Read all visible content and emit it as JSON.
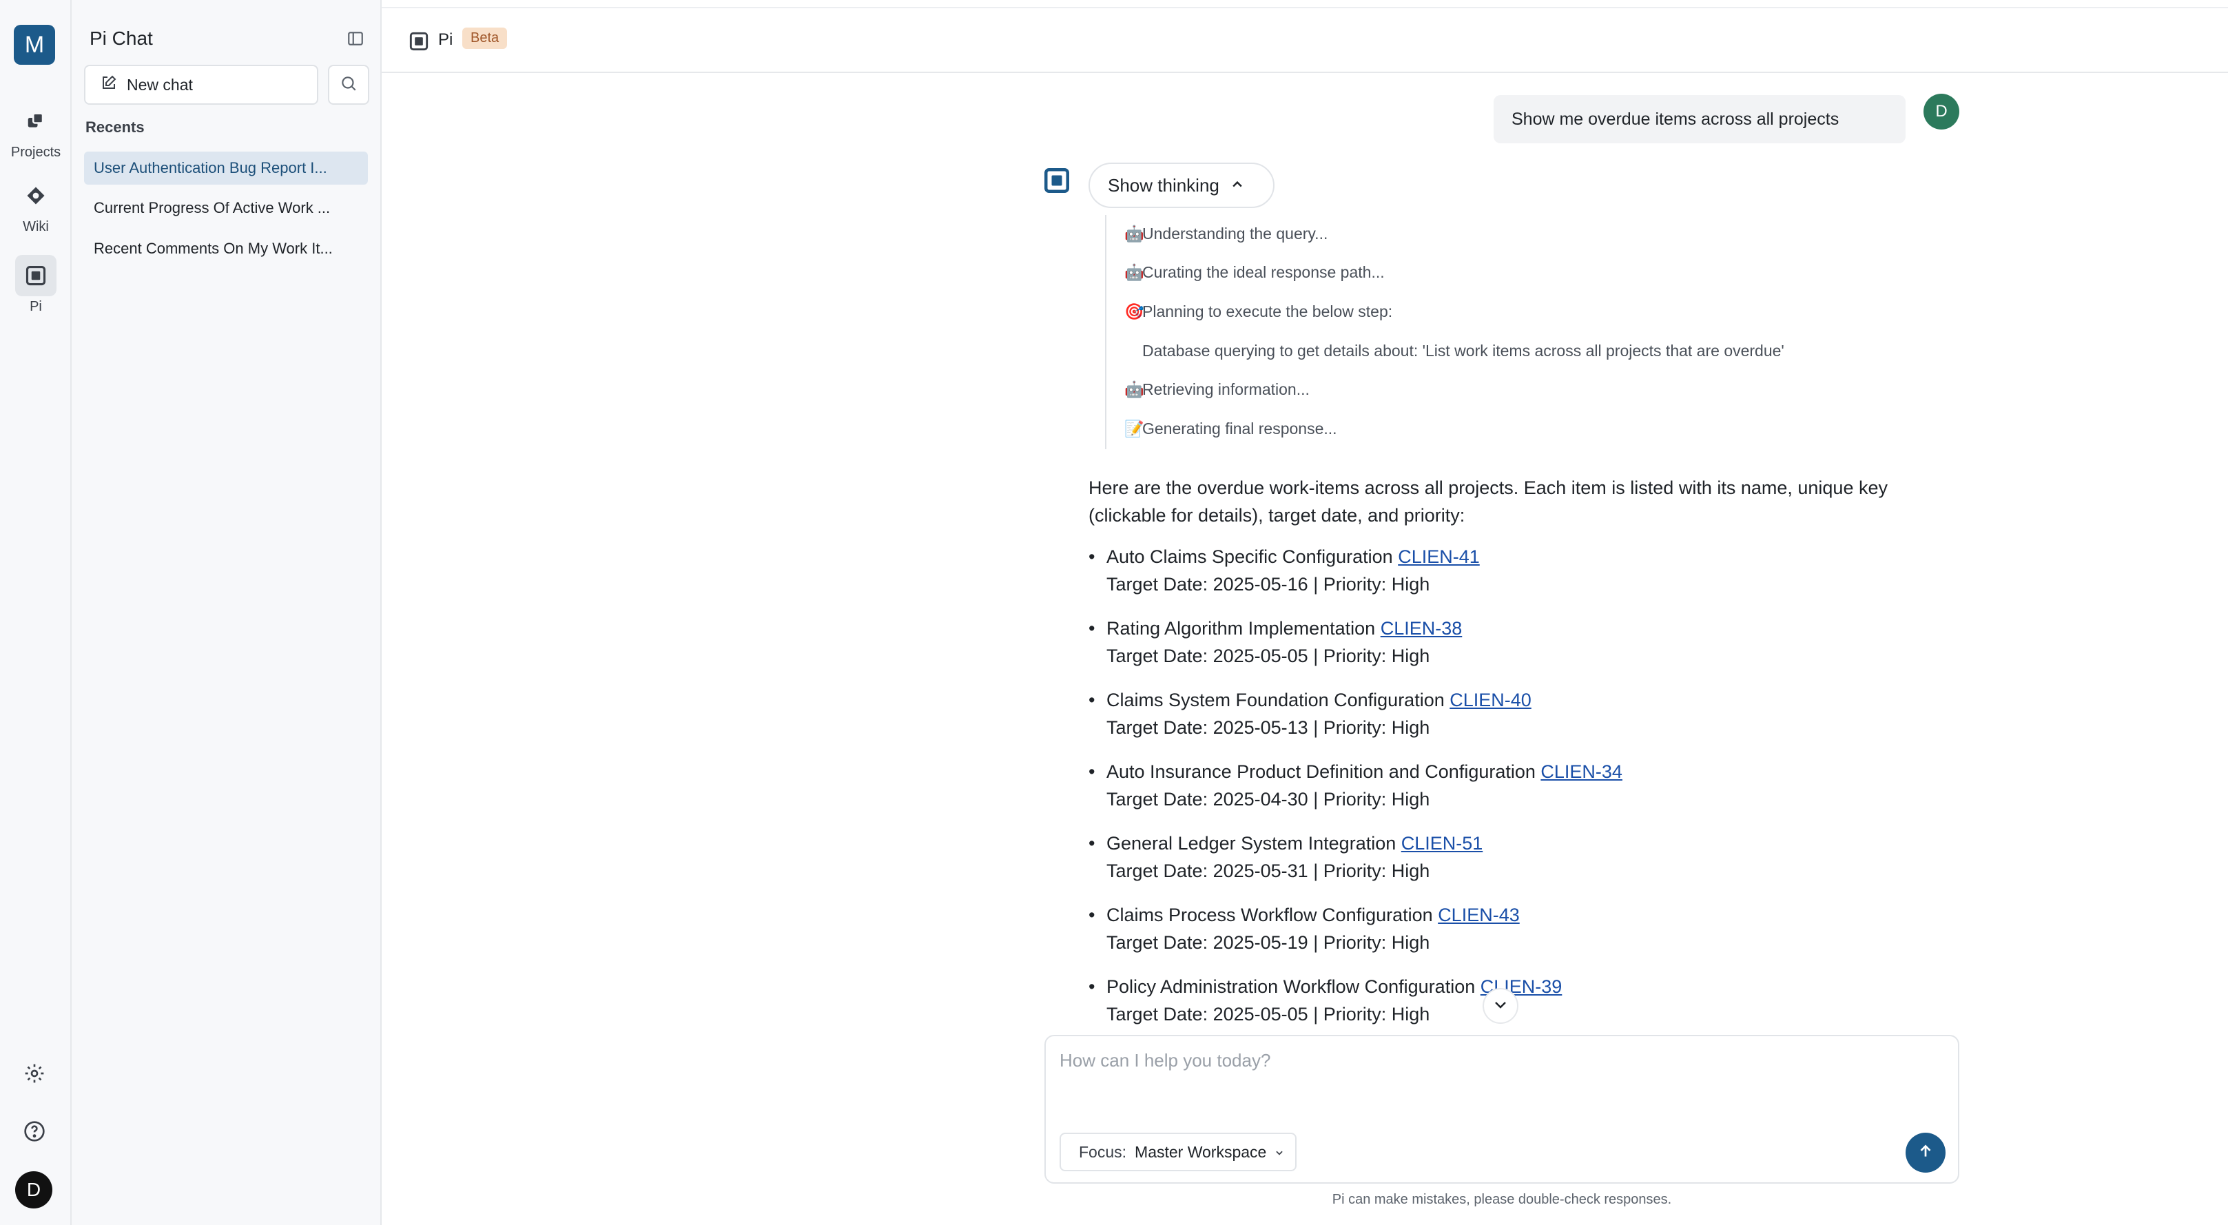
{
  "rail": {
    "workspace_initial": "M",
    "items": [
      {
        "label": "Projects",
        "icon": "projects-icon"
      },
      {
        "label": "Wiki",
        "icon": "wiki-icon"
      },
      {
        "label": "Pi",
        "icon": "pi-icon"
      }
    ],
    "user_initial": "D"
  },
  "sidebar": {
    "title": "Pi Chat",
    "new_chat_label": "New chat",
    "recents_label": "Recents",
    "recents": [
      "User Authentication Bug Report I...",
      "Current Progress Of Active Work ...",
      "Recent Comments On My Work It..."
    ]
  },
  "header": {
    "title": "Pi",
    "badge": "Beta"
  },
  "conversation": {
    "user_message": "Show me overdue items across all projects",
    "user_initial": "D",
    "thinking_label": "Show thinking",
    "steps": [
      {
        "emoji": "🤖",
        "text": "Understanding the query..."
      },
      {
        "emoji": "🤖",
        "text": "Curating the ideal response path..."
      },
      {
        "emoji": "🎯",
        "text": "Planning to execute the below step:"
      },
      {
        "emoji": "",
        "text": "Database querying to get details about: 'List work items across all projects that are overdue'"
      },
      {
        "emoji": "🤖",
        "text": "Retrieving information..."
      },
      {
        "emoji": "📝",
        "text": "Generating final response..."
      }
    ],
    "answer_intro": "Here are the overdue work-items across all projects. Each item is listed with its name, unique key (clickable for details), target date, and priority:",
    "items": [
      {
        "name": "Auto Claims Specific Configuration",
        "key": "CLIEN-41",
        "details": "Target Date: 2025-05-16 | Priority: High"
      },
      {
        "name": "Rating Algorithm Implementation",
        "key": "CLIEN-38",
        "details": "Target Date: 2025-05-05 | Priority: High"
      },
      {
        "name": "Claims System Foundation Configuration",
        "key": "CLIEN-40",
        "details": "Target Date: 2025-05-13 | Priority: High"
      },
      {
        "name": "Auto Insurance Product Definition and Configuration",
        "key": "CLIEN-34",
        "details": "Target Date: 2025-04-30 | Priority: High"
      },
      {
        "name": "General Ledger System Integration",
        "key": "CLIEN-51",
        "details": "Target Date: 2025-05-31 | Priority: High"
      },
      {
        "name": "Claims Process Workflow Configuration",
        "key": "CLIEN-43",
        "details": "Target Date: 2025-05-19 | Priority: High"
      },
      {
        "name": "Policy Administration Workflow Configuration",
        "key": "CLIEN-39",
        "details": "Target Date: 2025-05-05 | Priority: High"
      }
    ]
  },
  "composer": {
    "placeholder": "How can I help you today?",
    "focus_label": "Focus:",
    "focus_value": "Master Workspace"
  },
  "disclaimer": "Pi can make mistakes, please double-check responses.",
  "colors": {
    "brand": "#1c5a8a",
    "link": "#1a4fa8",
    "active_recent_bg": "#dde6f0",
    "beta_bg": "#f8dfc8"
  }
}
